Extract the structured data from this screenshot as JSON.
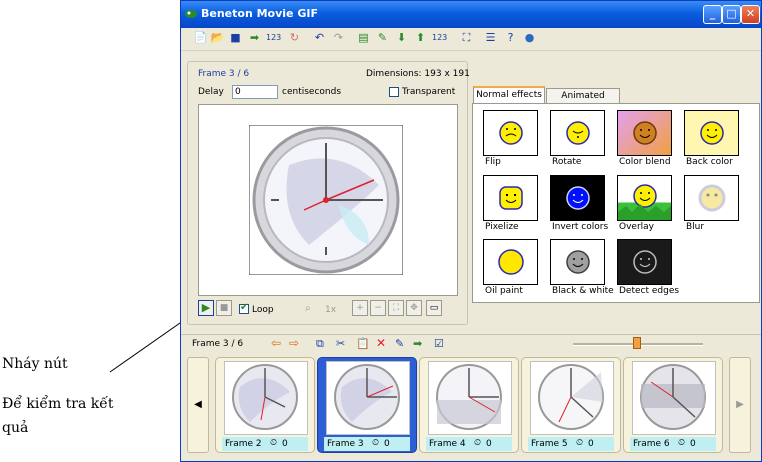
{
  "annotation": {
    "line1": "Nháy nút",
    "line2": "Để kiểm  tra kết",
    "line3": "quả"
  },
  "window": {
    "title": "Beneton Movie GIF"
  },
  "toolbar": [
    "new-icon",
    "open-icon",
    "save-icon",
    "export-icon",
    "renumber-icon",
    "refresh-icon",
    "undo-icon",
    "redo-icon",
    "add-frame-icon",
    "edit-frame-icon",
    "import-icon",
    "insert-icon",
    "sequence-icon",
    "resize-icon",
    "properties-icon",
    "help-icon",
    "web-icon"
  ],
  "frame_info": {
    "label": "Frame 3 / 6",
    "dimensions": "Dimensions: 193 x 191"
  },
  "delay": {
    "label": "Delay",
    "value": "0",
    "unit": "centiseconds"
  },
  "transparent": {
    "label": "Transparent"
  },
  "controls": {
    "loop_label": "Loop",
    "zoom_label": "1x"
  },
  "tabs": {
    "normal": "Normal effects",
    "animated": "Animated effects"
  },
  "effects": [
    "Flip",
    "Rotate",
    "Color blend",
    "Back color",
    "Pixelize",
    "Invert colors",
    "Overlay",
    "Blur",
    "Oil paint",
    "Black & white",
    "Detect edges"
  ],
  "strip": {
    "label": "Frame 3 / 6"
  },
  "frames": [
    {
      "name": "Frame 2",
      "delay": "0"
    },
    {
      "name": "Frame 3",
      "delay": "0"
    },
    {
      "name": "Frame 4",
      "delay": "0"
    },
    {
      "name": "Frame 5",
      "delay": "0"
    },
    {
      "name": "Frame 6",
      "delay": "0"
    }
  ],
  "colors": {
    "accent": "#2c5fd6",
    "title_bar": "#0a5ee0",
    "caption_bg": "#bfeff2"
  }
}
